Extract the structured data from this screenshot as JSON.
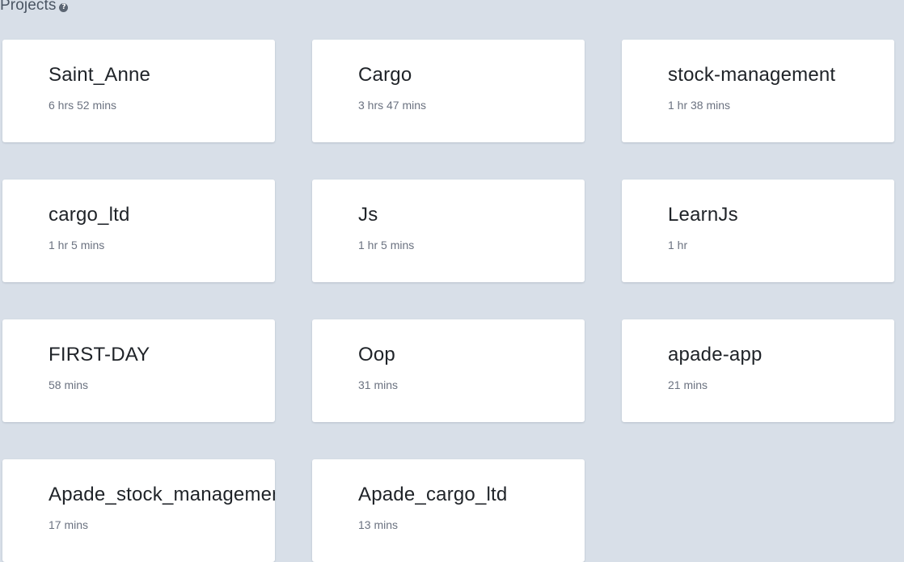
{
  "section": {
    "title": "Projects",
    "help_glyph": "?",
    "icon": "question-circle-icon"
  },
  "projects": [
    {
      "name": "Saint_Anne",
      "time": "6 hrs 52 mins"
    },
    {
      "name": "Cargo",
      "time": "3 hrs 47 mins"
    },
    {
      "name": "stock-management",
      "time": "1 hr 38 mins"
    },
    {
      "name": "cargo_ltd",
      "time": "1 hr 5 mins"
    },
    {
      "name": "Js",
      "time": "1 hr 5 mins"
    },
    {
      "name": "LearnJs",
      "time": "1 hr"
    },
    {
      "name": "FIRST-DAY",
      "time": "58 mins"
    },
    {
      "name": "Oop",
      "time": "31 mins"
    },
    {
      "name": "apade-app",
      "time": "21 mins"
    },
    {
      "name": "Apade_stock_management",
      "time": "17 mins"
    },
    {
      "name": "Apade_cargo_ltd",
      "time": "13 mins"
    }
  ],
  "colors": {
    "background": "#d8dfe8",
    "card": "#ffffff",
    "title_text": "#1f2328",
    "muted_text": "#6b7280"
  }
}
